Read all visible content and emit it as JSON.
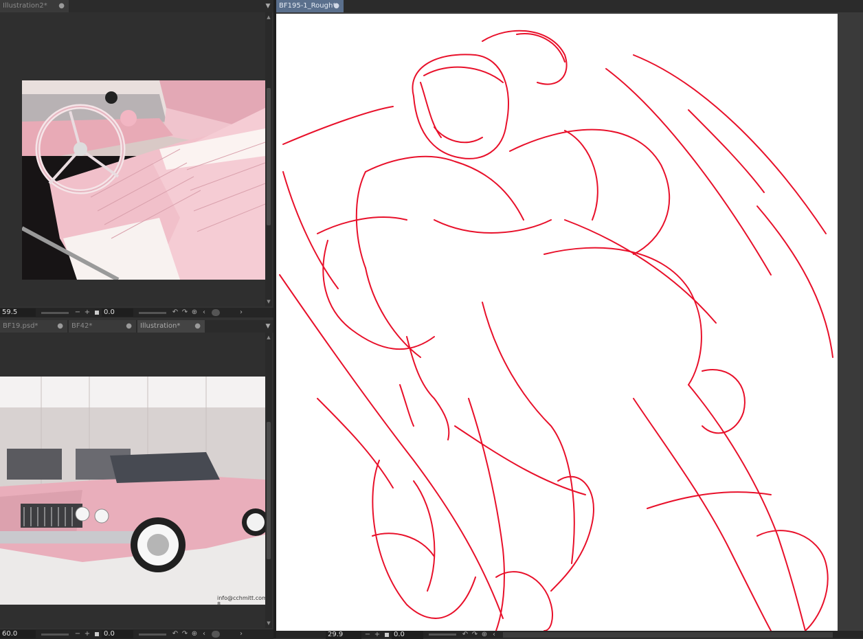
{
  "top_left_panel": {
    "tabs": [
      {
        "label": "Illustration2*",
        "dot": "●"
      }
    ],
    "zoom": "59.5",
    "angle": "0.0",
    "buttons": {
      "minus": "−",
      "plus": "+",
      "left": "‹",
      "right": "›"
    }
  },
  "bottom_left_panel": {
    "tabs": [
      {
        "label": "BF19.psd*",
        "dot": "●"
      },
      {
        "label": "BF42*",
        "dot": "●"
      },
      {
        "label": "Illustration*",
        "dot": "●"
      }
    ],
    "zoom": "60.0",
    "angle": "0.0",
    "watermark": "info@cchmitt.com",
    "watermark_suffix": "8"
  },
  "main_panel": {
    "tabs": [
      {
        "label": "BF195-1_Rough*",
        "dot": "●"
      }
    ],
    "zoom": "29.9",
    "angle": "0.0"
  },
  "colors": {
    "sketch": "#e8102a",
    "active_tab": "#5a6f8c",
    "pink": "#e8b8c4"
  }
}
